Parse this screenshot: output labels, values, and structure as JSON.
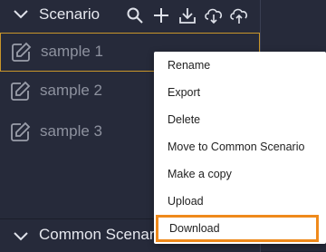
{
  "header": {
    "title": "Scenario",
    "icons": [
      "chevron-down-icon",
      "search-icon",
      "plus-icon",
      "download-tray-icon",
      "cloud-download-icon",
      "cloud-upload-icon"
    ]
  },
  "items": [
    {
      "label": "sample 1",
      "icon": "edit-icon"
    },
    {
      "label": "sample 2",
      "icon": "edit-icon"
    },
    {
      "label": "sample 3",
      "icon": "edit-icon"
    }
  ],
  "footer": {
    "title": "Common Scenario"
  },
  "context_menu": {
    "items": [
      "Rename",
      "Export",
      "Delete",
      "Move to Common Scenario",
      "Make a copy",
      "Upload",
      "Download"
    ],
    "highlighted": "Download"
  },
  "colors": {
    "accent": "#c9962a",
    "highlight": "#ef8a1c",
    "panel": "#262a3a"
  }
}
